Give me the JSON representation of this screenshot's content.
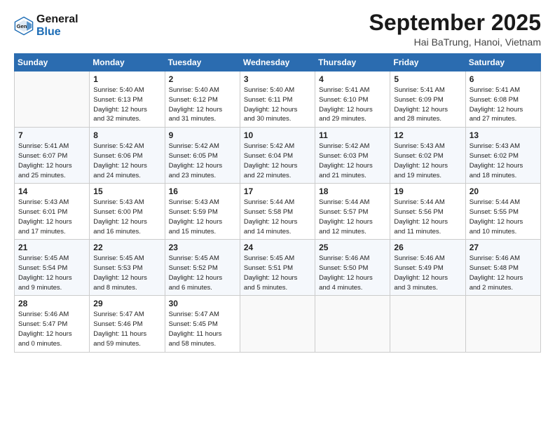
{
  "header": {
    "logo_line1": "General",
    "logo_line2": "Blue",
    "month": "September 2025",
    "location": "Hai BaTrung, Hanoi, Vietnam"
  },
  "days_of_week": [
    "Sunday",
    "Monday",
    "Tuesday",
    "Wednesday",
    "Thursday",
    "Friday",
    "Saturday"
  ],
  "weeks": [
    [
      {
        "day": "",
        "info": ""
      },
      {
        "day": "1",
        "info": "Sunrise: 5:40 AM\nSunset: 6:13 PM\nDaylight: 12 hours\nand 32 minutes."
      },
      {
        "day": "2",
        "info": "Sunrise: 5:40 AM\nSunset: 6:12 PM\nDaylight: 12 hours\nand 31 minutes."
      },
      {
        "day": "3",
        "info": "Sunrise: 5:40 AM\nSunset: 6:11 PM\nDaylight: 12 hours\nand 30 minutes."
      },
      {
        "day": "4",
        "info": "Sunrise: 5:41 AM\nSunset: 6:10 PM\nDaylight: 12 hours\nand 29 minutes."
      },
      {
        "day": "5",
        "info": "Sunrise: 5:41 AM\nSunset: 6:09 PM\nDaylight: 12 hours\nand 28 minutes."
      },
      {
        "day": "6",
        "info": "Sunrise: 5:41 AM\nSunset: 6:08 PM\nDaylight: 12 hours\nand 27 minutes."
      }
    ],
    [
      {
        "day": "7",
        "info": "Sunrise: 5:41 AM\nSunset: 6:07 PM\nDaylight: 12 hours\nand 25 minutes."
      },
      {
        "day": "8",
        "info": "Sunrise: 5:42 AM\nSunset: 6:06 PM\nDaylight: 12 hours\nand 24 minutes."
      },
      {
        "day": "9",
        "info": "Sunrise: 5:42 AM\nSunset: 6:05 PM\nDaylight: 12 hours\nand 23 minutes."
      },
      {
        "day": "10",
        "info": "Sunrise: 5:42 AM\nSunset: 6:04 PM\nDaylight: 12 hours\nand 22 minutes."
      },
      {
        "day": "11",
        "info": "Sunrise: 5:42 AM\nSunset: 6:03 PM\nDaylight: 12 hours\nand 21 minutes."
      },
      {
        "day": "12",
        "info": "Sunrise: 5:43 AM\nSunset: 6:02 PM\nDaylight: 12 hours\nand 19 minutes."
      },
      {
        "day": "13",
        "info": "Sunrise: 5:43 AM\nSunset: 6:02 PM\nDaylight: 12 hours\nand 18 minutes."
      }
    ],
    [
      {
        "day": "14",
        "info": "Sunrise: 5:43 AM\nSunset: 6:01 PM\nDaylight: 12 hours\nand 17 minutes."
      },
      {
        "day": "15",
        "info": "Sunrise: 5:43 AM\nSunset: 6:00 PM\nDaylight: 12 hours\nand 16 minutes."
      },
      {
        "day": "16",
        "info": "Sunrise: 5:43 AM\nSunset: 5:59 PM\nDaylight: 12 hours\nand 15 minutes."
      },
      {
        "day": "17",
        "info": "Sunrise: 5:44 AM\nSunset: 5:58 PM\nDaylight: 12 hours\nand 14 minutes."
      },
      {
        "day": "18",
        "info": "Sunrise: 5:44 AM\nSunset: 5:57 PM\nDaylight: 12 hours\nand 12 minutes."
      },
      {
        "day": "19",
        "info": "Sunrise: 5:44 AM\nSunset: 5:56 PM\nDaylight: 12 hours\nand 11 minutes."
      },
      {
        "day": "20",
        "info": "Sunrise: 5:44 AM\nSunset: 5:55 PM\nDaylight: 12 hours\nand 10 minutes."
      }
    ],
    [
      {
        "day": "21",
        "info": "Sunrise: 5:45 AM\nSunset: 5:54 PM\nDaylight: 12 hours\nand 9 minutes."
      },
      {
        "day": "22",
        "info": "Sunrise: 5:45 AM\nSunset: 5:53 PM\nDaylight: 12 hours\nand 8 minutes."
      },
      {
        "day": "23",
        "info": "Sunrise: 5:45 AM\nSunset: 5:52 PM\nDaylight: 12 hours\nand 6 minutes."
      },
      {
        "day": "24",
        "info": "Sunrise: 5:45 AM\nSunset: 5:51 PM\nDaylight: 12 hours\nand 5 minutes."
      },
      {
        "day": "25",
        "info": "Sunrise: 5:46 AM\nSunset: 5:50 PM\nDaylight: 12 hours\nand 4 minutes."
      },
      {
        "day": "26",
        "info": "Sunrise: 5:46 AM\nSunset: 5:49 PM\nDaylight: 12 hours\nand 3 minutes."
      },
      {
        "day": "27",
        "info": "Sunrise: 5:46 AM\nSunset: 5:48 PM\nDaylight: 12 hours\nand 2 minutes."
      }
    ],
    [
      {
        "day": "28",
        "info": "Sunrise: 5:46 AM\nSunset: 5:47 PM\nDaylight: 12 hours\nand 0 minutes."
      },
      {
        "day": "29",
        "info": "Sunrise: 5:47 AM\nSunset: 5:46 PM\nDaylight: 11 hours\nand 59 minutes."
      },
      {
        "day": "30",
        "info": "Sunrise: 5:47 AM\nSunset: 5:45 PM\nDaylight: 11 hours\nand 58 minutes."
      },
      {
        "day": "",
        "info": ""
      },
      {
        "day": "",
        "info": ""
      },
      {
        "day": "",
        "info": ""
      },
      {
        "day": "",
        "info": ""
      }
    ]
  ]
}
